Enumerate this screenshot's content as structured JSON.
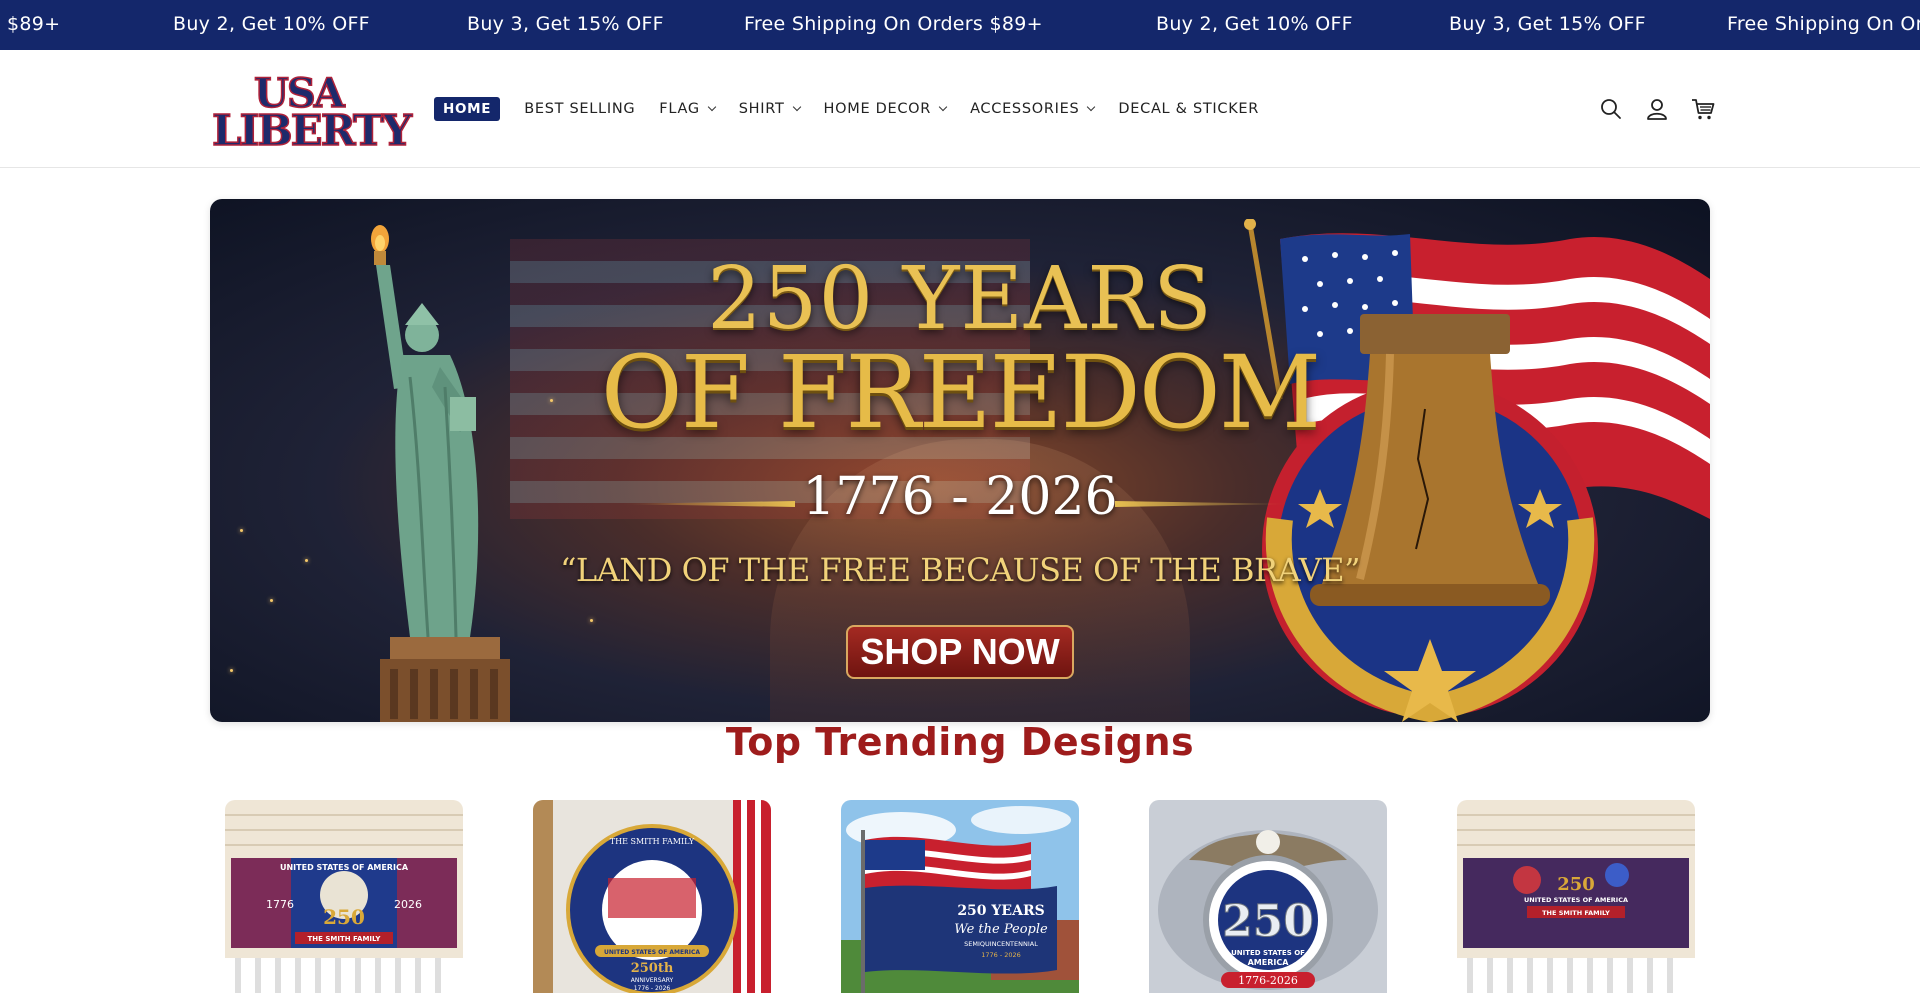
{
  "announcement": {
    "items": [
      "$89+",
      "Buy 2, Get 10% OFF",
      "Buy 3, Get 15% OFF",
      "Free Shipping On Orders $89+",
      "Buy 2, Get 10% OFF",
      "Buy 3, Get 15% OFF",
      "Free Shipping On Or"
    ]
  },
  "header": {
    "logo_top": "USA",
    "logo_bottom": "LIBERTY",
    "nav": [
      {
        "label": "HOME"
      },
      {
        "label": "BEST SELLING"
      },
      {
        "label": "FLAG"
      },
      {
        "label": "SHIRT"
      },
      {
        "label": "HOME DECOR"
      },
      {
        "label": "ACCESSORIES"
      },
      {
        "label": "DECAL & STICKER"
      }
    ],
    "icons": [
      "search-icon",
      "account-icon",
      "cart-icon"
    ]
  },
  "hero": {
    "title_line1": "250 YEARS",
    "title_line2": "OF FREEDOM",
    "dates": "1776 - 2026",
    "quote": "“LAND OF THE FREE BECAUSE OF THE BRAVE”",
    "button": "SHOP NOW"
  },
  "trending": {
    "title": "Top Trending Designs",
    "products": [
      {
        "top": "UNITED STATES OF AMERICA",
        "left_year": "1776",
        "right_year": "2026",
        "center": "250",
        "family": "THE SMITH FAMILY"
      },
      {
        "top": "THE SMITH FAMILY",
        "banner": "UNITED STATES OF AMERICA",
        "center": "250th",
        "sub": "ANNIVERSARY",
        "years": "1776 - 2026"
      },
      {
        "title": "250 YEARS",
        "script": "We the People",
        "sub": "SEMIQUINCENTENNIAL",
        "years": "1776 - 2026"
      },
      {
        "center": "250",
        "sub": "UNITED STATES OF",
        "sub2": "AMERICA",
        "years": "1776-2026"
      },
      {
        "top": "UNITED STATES OF AMERICA",
        "family": "THE SMITH FAMILY",
        "center": "250"
      }
    ]
  },
  "colors": {
    "announcement_bg": "#14276b",
    "nav_active_bg": "#14276b",
    "section_title": "#9e1c1c",
    "gold": "#e6bb48"
  }
}
